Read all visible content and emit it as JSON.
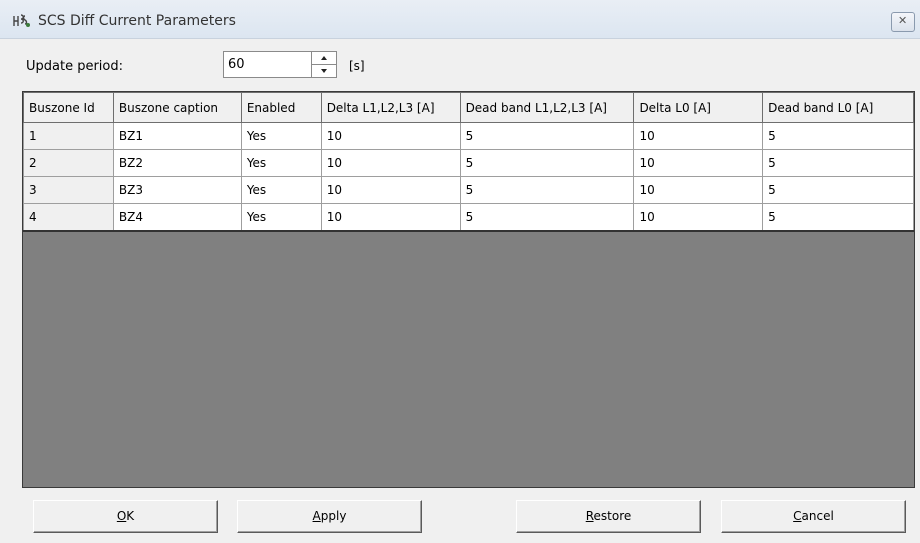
{
  "window": {
    "title": "SCS Diff Current Parameters",
    "close_glyph": "✕"
  },
  "update": {
    "label": "Update period:",
    "value": "60",
    "unit": "[s]"
  },
  "table": {
    "headers": [
      "Buszone Id",
      "Buszone caption",
      "Enabled",
      "Delta L1,L2,L3 [A]",
      "Dead band L1,L2,L3 [A]",
      "Delta L0 [A]",
      "Dead band L0 [A]"
    ],
    "rows": [
      [
        "1",
        "BZ1",
        "Yes",
        "10",
        "5",
        "10",
        "5"
      ],
      [
        "2",
        "BZ2",
        "Yes",
        "10",
        "5",
        "10",
        "5"
      ],
      [
        "3",
        "BZ3",
        "Yes",
        "10",
        "5",
        "10",
        "5"
      ],
      [
        "4",
        "BZ4",
        "Yes",
        "10",
        "5",
        "10",
        "5"
      ]
    ]
  },
  "buttons": {
    "ok": {
      "accel": "O",
      "rest": "K"
    },
    "apply": {
      "accel": "A",
      "rest": "pply"
    },
    "restore": {
      "accel": "R",
      "rest": "estore"
    },
    "cancel": {
      "accel": "C",
      "rest": "ancel"
    }
  }
}
